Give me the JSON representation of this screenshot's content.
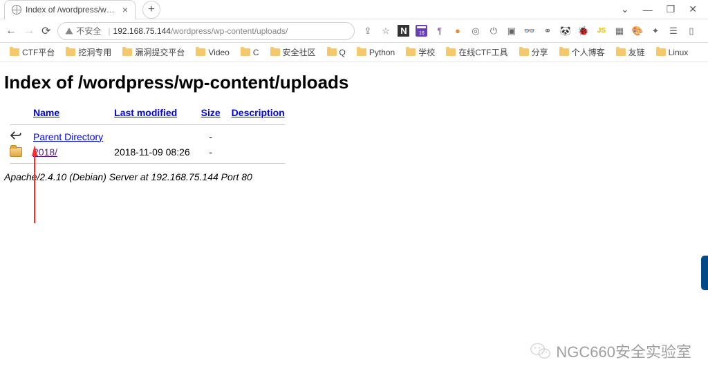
{
  "window": {
    "tab_title": "Index of /wordpress/wp-conte",
    "minimize": "—",
    "maximize": "❐",
    "close": "✕",
    "chevron": "⌄",
    "new_tab": "+"
  },
  "addressbar": {
    "insecure_label": "不安全",
    "host": "192.168.75.144",
    "path": "/wordpress/wp-content/uploads/"
  },
  "bookmarks": [
    "CTF平台",
    "挖洞专用",
    "漏洞提交平台",
    "Video",
    "C",
    "安全社区",
    "Q",
    "Python",
    "学校",
    "在线CTF工具",
    "分享",
    "个人博客",
    "友链",
    "Linux"
  ],
  "page": {
    "heading": "Index of /wordpress/wp-content/uploads",
    "columns": {
      "name": "Name",
      "modified": "Last modified",
      "size": "Size",
      "desc": "Description"
    },
    "rows": [
      {
        "icon": "back",
        "name": "Parent Directory",
        "modified": "",
        "size": "-",
        "link_class": ""
      },
      {
        "icon": "dir",
        "name": "2018/",
        "modified": "2018-11-09 08:26",
        "size": "-",
        "link_class": "visited"
      }
    ],
    "server_line": "Apache/2.4.10 (Debian) Server at 192.168.75.144 Port 80"
  },
  "watermark": "NGC660安全实验室"
}
